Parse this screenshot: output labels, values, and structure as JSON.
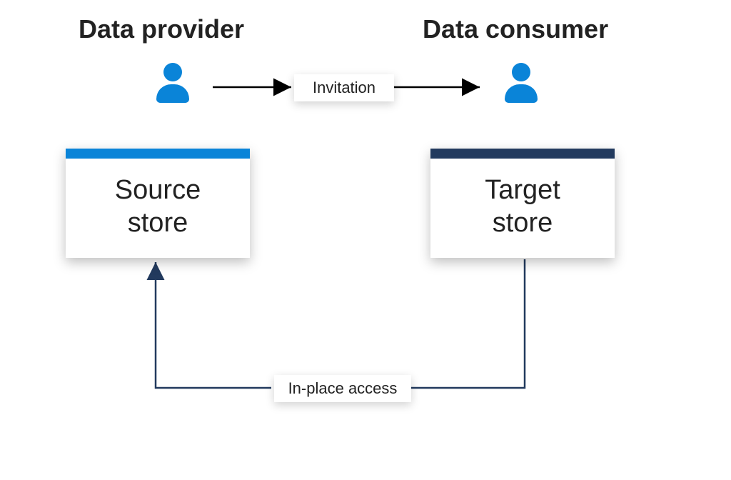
{
  "titles": {
    "provider": "Data provider",
    "consumer": "Data consumer"
  },
  "people": {
    "provider_color": "#0a84d8",
    "consumer_color": "#0a84d8"
  },
  "boxes": {
    "source": {
      "line1": "Source",
      "line2": "store",
      "bar_color": "#0a84d8"
    },
    "target": {
      "line1": "Target",
      "line2": "store",
      "bar_color": "#223a5e"
    }
  },
  "labels": {
    "invitation": "Invitation",
    "inplace": "In-place access"
  },
  "arrow_colors": {
    "invitation": "#000000",
    "inplace": "#223a5e"
  }
}
